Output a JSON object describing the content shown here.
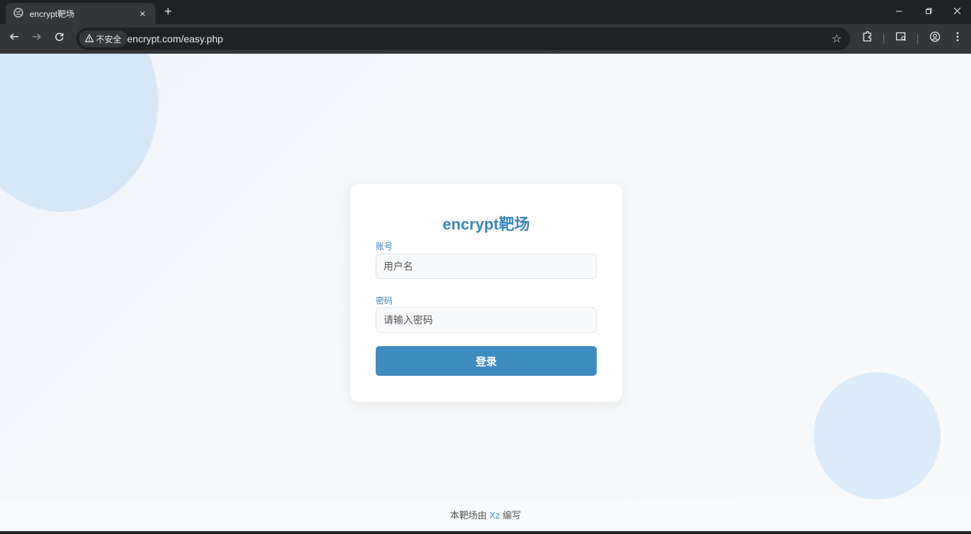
{
  "browser": {
    "tab_title": "encrypt靶场",
    "new_tab": "+",
    "tab_close": "×",
    "security_label": "不安全",
    "url": "encrypt.com/easy.php"
  },
  "page": {
    "title": "encrypt靶场",
    "account_label": "账号",
    "account_placeholder": "用户名",
    "password_label": "密码",
    "password_placeholder": "请输入密码",
    "login_button": "登录",
    "footer_prefix": "本靶场由",
    "footer_author": "Xz",
    "footer_suffix": "编写"
  },
  "colors": {
    "accent": "#3d8bbf",
    "title": "#3a86b9",
    "link": "#3a9ad9"
  }
}
